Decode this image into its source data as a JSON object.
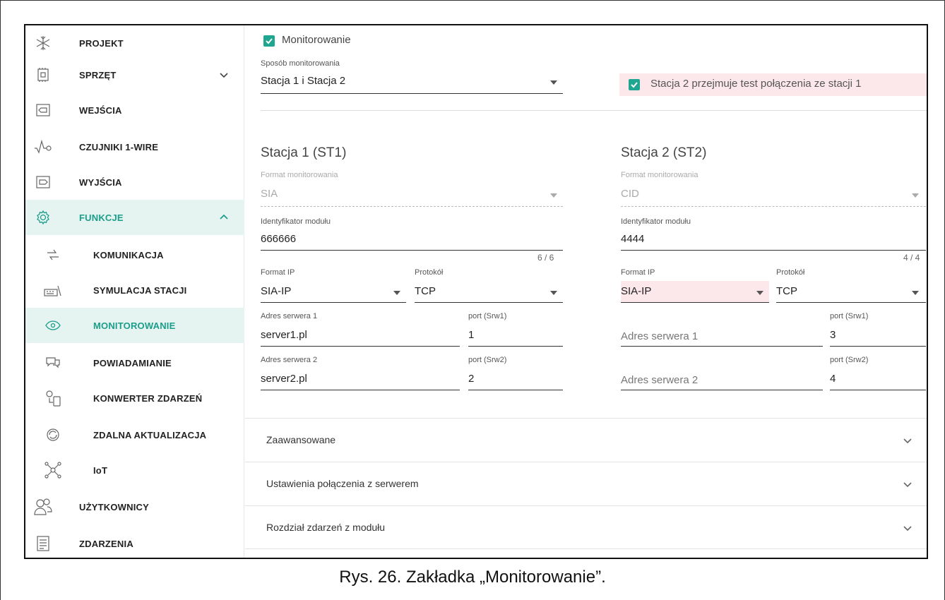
{
  "sidebar": {
    "items": [
      {
        "label": "PROJEKT",
        "icon": "snowflake-icon"
      },
      {
        "label": "SPRZĘT",
        "icon": "chip-icon"
      },
      {
        "label": "WEJŚCIA",
        "icon": "input-icon"
      },
      {
        "label": "CZUJNIKI 1-WIRE",
        "icon": "sensor-wave-icon"
      },
      {
        "label": "WYJŚCIA",
        "icon": "output-icon"
      },
      {
        "label": "FUNKCJE",
        "icon": "gear-icon"
      },
      {
        "label": "KOMUNIKACJA",
        "icon": "arrows-icon"
      },
      {
        "label": "SYMULACJA STACJI",
        "icon": "keyboard-icon"
      },
      {
        "label": "MONITOROWANIE",
        "icon": "eye-icon"
      },
      {
        "label": "POWIADAMIANIE",
        "icon": "chat-icon"
      },
      {
        "label": "KONWERTER ZDARZEŃ",
        "icon": "converter-icon"
      },
      {
        "label": "ZDALNA AKTUALIZACJA",
        "icon": "refresh-icon"
      },
      {
        "label": "IoT",
        "icon": "network-icon"
      },
      {
        "label": "UŻYTKOWNICY",
        "icon": "users-icon"
      },
      {
        "label": "ZDARZENIA",
        "icon": "document-icon"
      }
    ]
  },
  "main": {
    "monitoring_checkbox_label": "Monitorowanie",
    "method": {
      "label": "Sposób monitorowania",
      "value": "Stacja 1 i Stacja 2"
    },
    "takeover_checkbox_label": "Stacja 2 przejmuje test połączenia ze stacji 1",
    "st1": {
      "title": "Stacja 1 (ST1)",
      "format_label": "Format monitorowania",
      "format_value": "SIA",
      "id_label": "Identyfikator modułu",
      "id_value": "666666",
      "id_counter": "6 / 6",
      "ipformat_label": "Format IP",
      "ipformat_value": "SIA-IP",
      "protocol_label": "Protokół",
      "protocol_value": "TCP",
      "srv1_label": "Adres serwera 1",
      "srv1_value": "server1.pl",
      "port1_label": "port (Srw1)",
      "port1_value": "1",
      "srv2_label": "Adres serwera 2",
      "srv2_value": "server2.pl",
      "port2_label": "port (Srw2)",
      "port2_value": "2"
    },
    "st2": {
      "title": "Stacja 2 (ST2)",
      "format_label": "Format monitorowania",
      "format_value": "CID",
      "id_label": "Identyfikator modułu",
      "id_value": "4444",
      "id_counter": "4 / 4",
      "ipformat_label": "Format IP",
      "ipformat_value": "SIA-IP",
      "protocol_label": "Protokół",
      "protocol_value": "TCP",
      "srv1_placeholder": "Adres serwera 1",
      "port1_label": "port (Srw1)",
      "port1_value": "3",
      "srv2_placeholder": "Adres serwera 2",
      "port2_label": "port (Srw2)",
      "port2_value": "4"
    },
    "accordions": [
      "Zaawansowane",
      "Ustawienia połączenia z serwerem",
      "Rozdział zdarzeń z modułu"
    ]
  },
  "caption": "Rys. 26. Zakładka „Monitorowanie”.",
  "colors": {
    "accent": "#1fa690",
    "active_bg": "#e6f4f1",
    "error_bg": "#fce8ea"
  }
}
